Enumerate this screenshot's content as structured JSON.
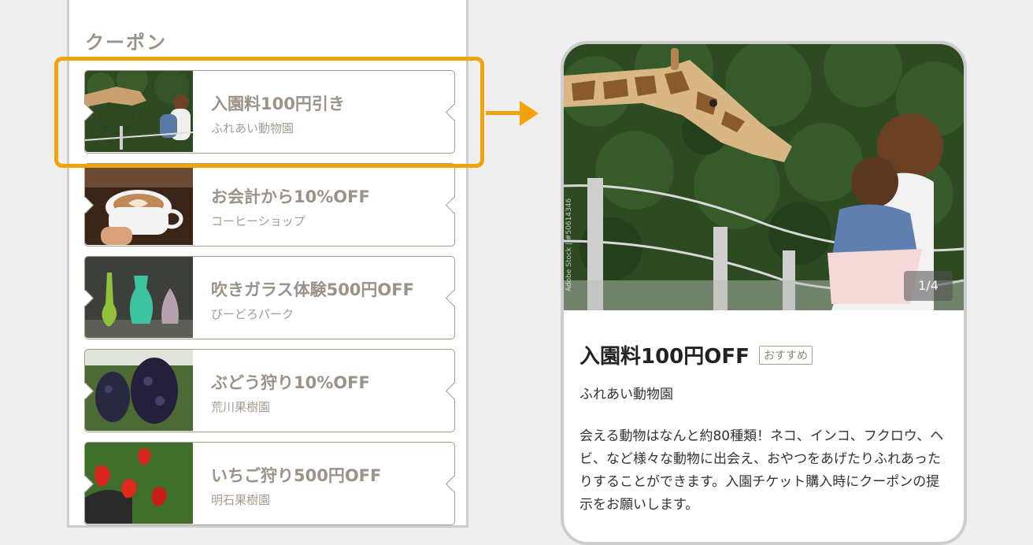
{
  "list": {
    "section_title": "クーポン",
    "coupons": [
      {
        "title": "入園料100円引き",
        "shop": "ふれあい動物園",
        "image": "giraffe-photo"
      },
      {
        "title": "お会計から10%OFF",
        "shop": "コーヒーショップ",
        "image": "latte-photo"
      },
      {
        "title": "吹きガラス体験500円OFF",
        "shop": "びーどろパーク",
        "image": "glass-vase-photo"
      },
      {
        "title": "ぶどう狩り10%OFF",
        "shop": "荒川果樹園",
        "image": "grape-photo"
      },
      {
        "title": "いちご狩り500円OFF",
        "shop": "明石果樹園",
        "image": "strawberry-photo"
      }
    ]
  },
  "detail": {
    "image_counter": "1/4",
    "image_credit": "Adobe Stock | #50614346",
    "title": "入園料100円OFF",
    "badge": "おすすめ",
    "shop": "ふれあい動物園",
    "description": "会える動物はなんと約80種類！ネコ、インコ、フクロウ、ヘビ、など様々な動物に出会え、おやつをあげたりふれあったりすることができます。入園チケット購入時にクーポンの提示をお願いします。"
  },
  "colors": {
    "accent": "#f0a30a",
    "text_muted": "#9c9287",
    "border": "#a89c8f"
  }
}
